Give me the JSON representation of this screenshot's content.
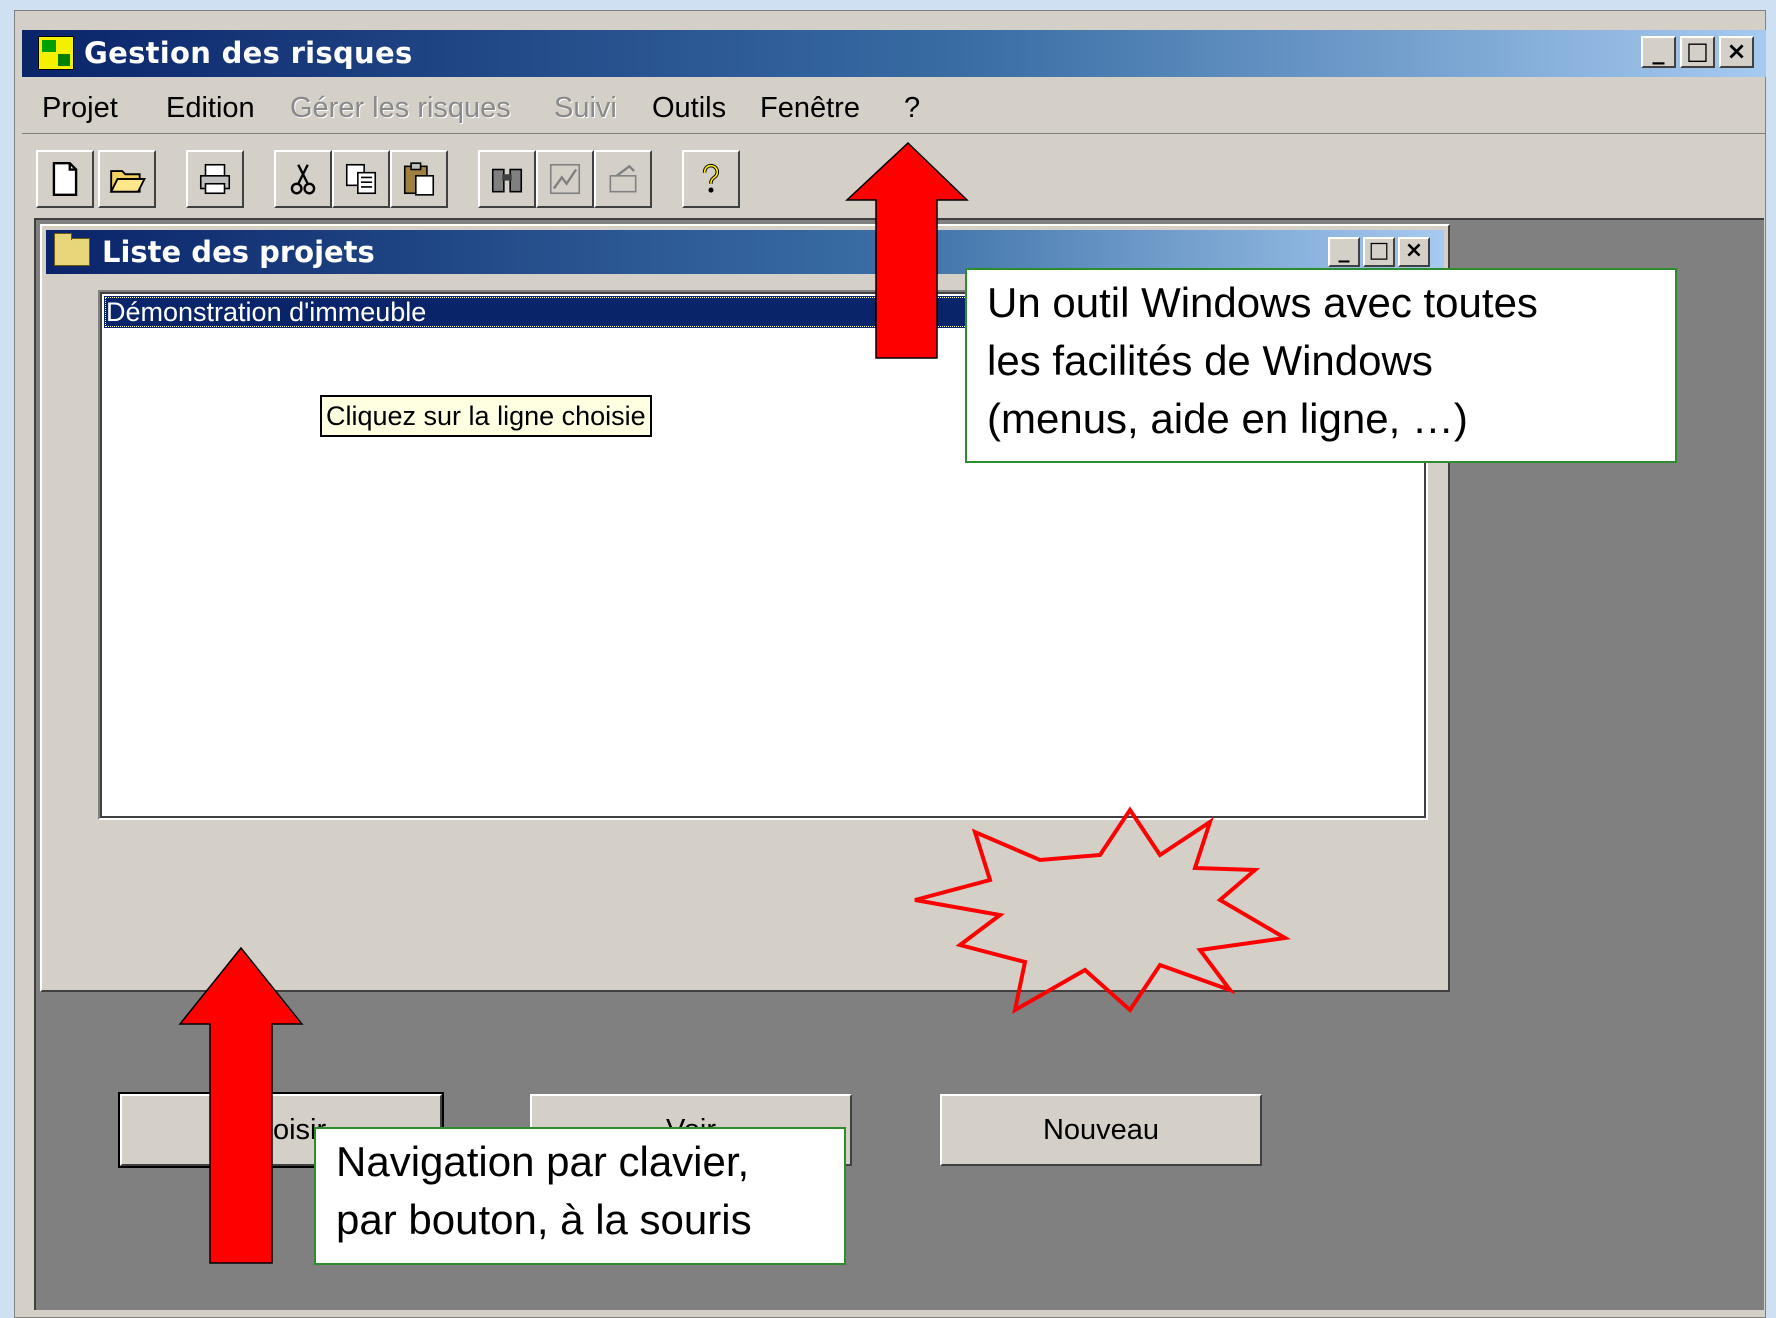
{
  "window": {
    "title": "Gestion des risques",
    "controls": [
      "_",
      "□",
      "×"
    ]
  },
  "menubar": {
    "items": [
      {
        "label": "Projet",
        "enabled": true
      },
      {
        "label": "Edition",
        "enabled": true
      },
      {
        "label": "Gérer les risques",
        "enabled": false
      },
      {
        "label": "Suivi",
        "enabled": false
      },
      {
        "label": "Outils",
        "enabled": true
      },
      {
        "label": "Fenêtre",
        "enabled": true
      },
      {
        "label": "?",
        "enabled": true
      }
    ]
  },
  "toolbar": {
    "buttons": [
      "new-file-icon",
      "open-folder-icon",
      "print-icon",
      "cut-icon",
      "copy-icon",
      "paste-icon",
      "find-icon",
      "chart-icon",
      "report-icon",
      "help-icon"
    ]
  },
  "child_window": {
    "title": "Liste des projets",
    "list_items": [
      "Démonstration d'immeuble"
    ],
    "tooltip": "Cliquez sur la ligne choisie",
    "buttons": {
      "choose": "Choisir",
      "view": "Voir",
      "new": "Nouveau"
    }
  },
  "callouts": {
    "top": [
      "Un outil Windows avec toutes",
      "les facilités de Windows",
      "(menus, aide en ligne, …)"
    ],
    "bottom": [
      "Navigation par clavier,",
      "par bouton, à la souris"
    ]
  },
  "colors": {
    "titlebar_start": "#0a246a",
    "titlebar_end": "#a6caf0",
    "window_face": "#d4d0c8",
    "mdi_background": "#808080",
    "arrow": "#ff0000",
    "starburst": "#ff0000",
    "callout_border": "#2e8b2e"
  }
}
